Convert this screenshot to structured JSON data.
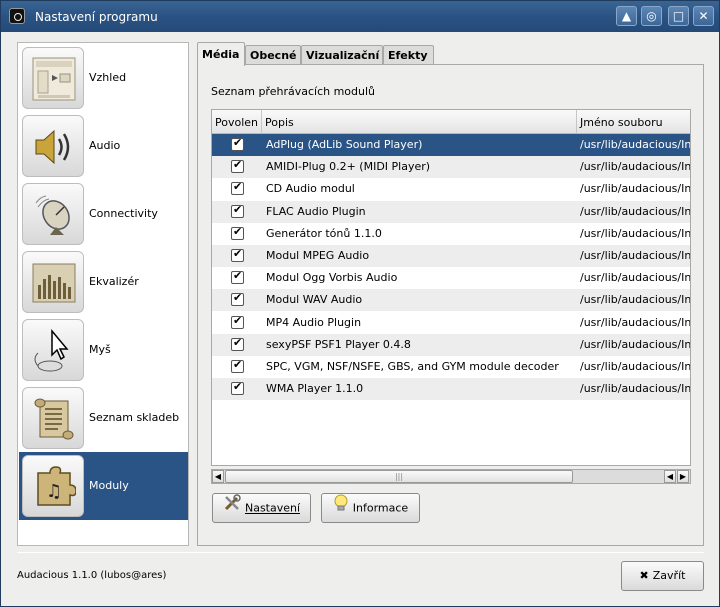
{
  "window": {
    "title": "Nastavení programu",
    "buttons": [
      "roll-up",
      "stick",
      "maximize",
      "close"
    ]
  },
  "sidebar": {
    "items": [
      {
        "label": "Vzhled",
        "icon": "appearance-icon"
      },
      {
        "label": "Audio",
        "icon": "speaker-icon"
      },
      {
        "label": "Connectivity",
        "icon": "satellite-dish-icon"
      },
      {
        "label": "Ekvalizér",
        "icon": "equalizer-icon"
      },
      {
        "label": "Myš",
        "icon": "mouse-icon"
      },
      {
        "label": "Seznam skladeb",
        "icon": "scroll-icon"
      },
      {
        "label": "Moduly",
        "icon": "puzzle-icon",
        "selected": true
      }
    ]
  },
  "tabs": [
    {
      "label": "Média",
      "active": true
    },
    {
      "label": "Obecné"
    },
    {
      "label": "Vizualizační"
    },
    {
      "label": "Efekty"
    }
  ],
  "section": {
    "label": "Seznam přehrávacích modulů"
  },
  "table": {
    "columns": [
      "Povolen",
      "Popis",
      "Jméno souboru"
    ],
    "rows": [
      {
        "enabled": true,
        "description": "AdPlug (AdLib Sound Player)",
        "filename": "/usr/lib/audacious/In",
        "selected": true
      },
      {
        "enabled": true,
        "description": "AMIDI-Plug 0.2+ (MIDI Player)",
        "filename": "/usr/lib/audacious/In"
      },
      {
        "enabled": true,
        "description": "CD Audio modul",
        "filename": "/usr/lib/audacious/In"
      },
      {
        "enabled": true,
        "description": "FLAC Audio Plugin",
        "filename": "/usr/lib/audacious/In"
      },
      {
        "enabled": true,
        "description": "Generátor tónů 1.1.0",
        "filename": "/usr/lib/audacious/In"
      },
      {
        "enabled": true,
        "description": "Modul MPEG Audio",
        "filename": "/usr/lib/audacious/In"
      },
      {
        "enabled": true,
        "description": "Modul Ogg Vorbis Audio",
        "filename": "/usr/lib/audacious/In"
      },
      {
        "enabled": true,
        "description": "Modul WAV Audio",
        "filename": "/usr/lib/audacious/In"
      },
      {
        "enabled": true,
        "description": "MP4 Audio Plugin",
        "filename": "/usr/lib/audacious/In"
      },
      {
        "enabled": true,
        "description": "sexyPSF PSF1 Player 0.4.8",
        "filename": "/usr/lib/audacious/In"
      },
      {
        "enabled": true,
        "description": "SPC, VGM, NSF/NSFE, GBS, and GYM module decoder",
        "filename": "/usr/lib/audacious/In"
      },
      {
        "enabled": true,
        "description": "WMA Player 1.1.0",
        "filename": "/usr/lib/audacious/In"
      }
    ]
  },
  "buttons": {
    "settings": "Nastavení",
    "info": "Informace",
    "close": "Zavřít"
  },
  "status": "Audacious 1.1.0 (lubos@ares)",
  "colors": {
    "titlebar": "#2a5283",
    "selection": "#2b5486",
    "alt_row": "#ededed"
  }
}
